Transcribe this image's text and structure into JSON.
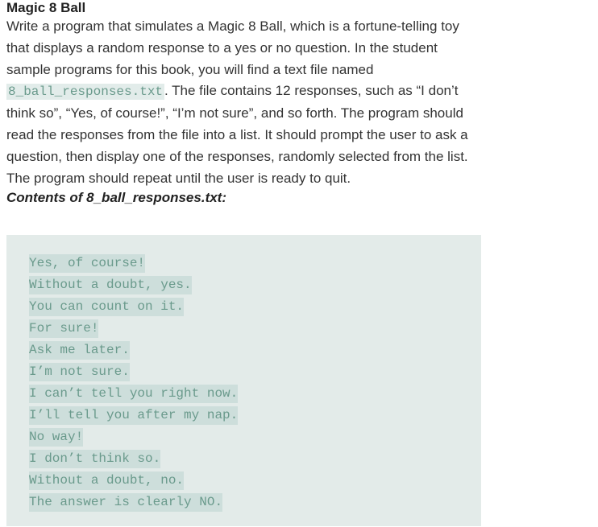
{
  "document": {
    "title": "Magic 8 Ball",
    "paragraph": {
      "part1": "Write a program that simulates a Magic 8 Ball, which is a fortune-telling toy that displays a random response to a yes or no question. In the student sample programs for this book, you will find a text file named ",
      "filename": "8_ball_responses.txt",
      "part2": ". The file contains 12 responses, such as “I don’t think so”, “Yes, of course!”, “I’m not sure”, and so forth. The program should read the responses from the file into a list. It should prompt the user to ask a question, then display one of the responses, randomly selected from the list. The program should repeat until the user is ready to quit."
    },
    "contents_heading": "Contents of 8_ball_responses.txt:",
    "file_contents": [
      "Yes, of course!",
      "Without a doubt, yes.",
      "You can count on it.",
      "For sure!",
      "Ask me later.",
      "I’m not sure.",
      "I can’t tell you right now.",
      "I’ll tell you after my nap.",
      "No way!",
      "I don’t think so.",
      "Without a doubt, no.",
      "The answer is clearly NO."
    ]
  },
  "colors": {
    "code_text": "#6a9a8c",
    "code_block_bg": "#e3ebe9",
    "code_highlight_bg": "#cddedb",
    "body_text": "#333333"
  }
}
